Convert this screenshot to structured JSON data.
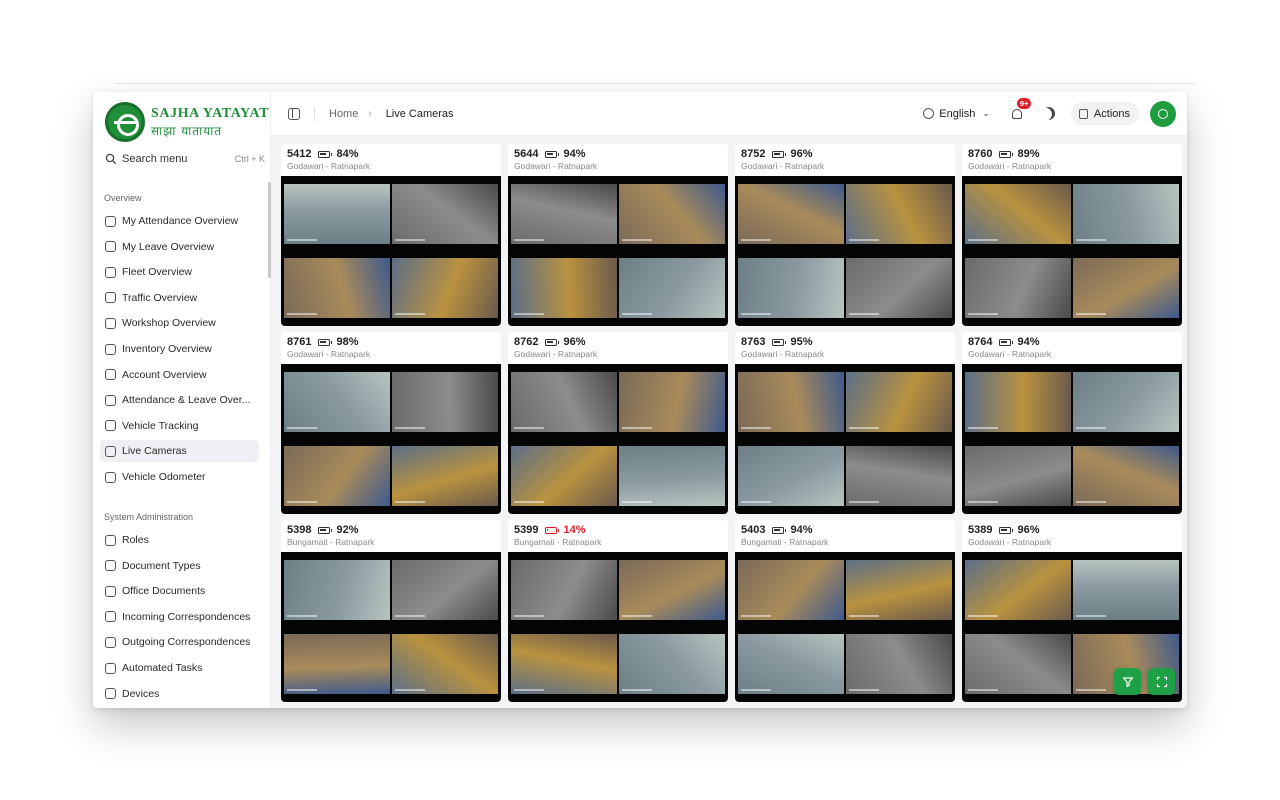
{
  "brand": {
    "name_en": "SAJHA YATAYAT",
    "name_np": "साझा यातायात"
  },
  "search": {
    "label": "Search menu",
    "shortcut": "Ctrl + K"
  },
  "sections": {
    "overview": "Overview",
    "admin": "System Administration"
  },
  "nav_overview": [
    {
      "label": "My Attendance Overview",
      "icon": "fingerprint-icon"
    },
    {
      "label": "My Leave Overview",
      "icon": "user-leave-icon"
    },
    {
      "label": "Fleet Overview",
      "icon": "bus-icon"
    },
    {
      "label": "Traffic Overview",
      "icon": "route-icon"
    },
    {
      "label": "Workshop Overview",
      "icon": "clipboard-icon"
    },
    {
      "label": "Inventory Overview",
      "icon": "warehouse-icon"
    },
    {
      "label": "Account Overview",
      "icon": "bank-icon"
    },
    {
      "label": "Attendance & Leave Over...",
      "icon": "users-icon"
    },
    {
      "label": "Vehicle Tracking",
      "icon": "map-icon"
    },
    {
      "label": "Live Cameras",
      "icon": "video-camera-icon",
      "active": true
    },
    {
      "label": "Vehicle Odometer",
      "icon": "gauge-icon"
    }
  ],
  "nav_admin": [
    {
      "label": "Roles",
      "icon": "user-cog-icon"
    },
    {
      "label": "Document Types",
      "icon": "file-icon"
    },
    {
      "label": "Office Documents",
      "icon": "file-text-icon"
    },
    {
      "label": "Incoming Correspondences",
      "icon": "file-in-icon"
    },
    {
      "label": "Outgoing Correspondences",
      "icon": "file-out-icon"
    },
    {
      "label": "Automated Tasks",
      "icon": "bot-icon"
    },
    {
      "label": "Devices",
      "icon": "device-icon"
    }
  ],
  "header": {
    "breadcrumb": [
      "Home",
      "Live Cameras"
    ],
    "language": "English",
    "notifications": "9+",
    "actions": "Actions"
  },
  "colors": {
    "brand": "#1f8f3a",
    "accent": "#1fa046",
    "danger": "#e11d2a"
  },
  "cameras": [
    {
      "bus": "5412",
      "battery": "84%",
      "route": "Godawari - Ratnapark",
      "low": false
    },
    {
      "bus": "5644",
      "battery": "94%",
      "route": "Godawari - Ratnapark",
      "low": false
    },
    {
      "bus": "8752",
      "battery": "96%",
      "route": "Godawari - Ratnapark",
      "low": false
    },
    {
      "bus": "8760",
      "battery": "89%",
      "route": "Godawari - Ratnapark",
      "low": false
    },
    {
      "bus": "8761",
      "battery": "98%",
      "route": "Godawari - Ratnapark",
      "low": false
    },
    {
      "bus": "8762",
      "battery": "96%",
      "route": "Godawari - Ratnapark",
      "low": false
    },
    {
      "bus": "8763",
      "battery": "95%",
      "route": "Godawari - Ratnapark",
      "low": false
    },
    {
      "bus": "8764",
      "battery": "94%",
      "route": "Godawari - Ratnapark",
      "low": false
    },
    {
      "bus": "5398",
      "battery": "92%",
      "route": "Bungamati - Ratnapark",
      "low": false
    },
    {
      "bus": "5399",
      "battery": "14%",
      "route": "Bungamati - Ratnapark",
      "low": true
    },
    {
      "bus": "5403",
      "battery": "94%",
      "route": "Bungamati - Ratnapark",
      "low": false
    },
    {
      "bus": "5389",
      "battery": "96%",
      "route": "Godawari - Ratnapark",
      "low": false
    }
  ],
  "fabs": [
    {
      "name": "filter-button",
      "icon": "filter-icon"
    },
    {
      "name": "fullscreen-button",
      "icon": "fullscreen-icon"
    }
  ]
}
